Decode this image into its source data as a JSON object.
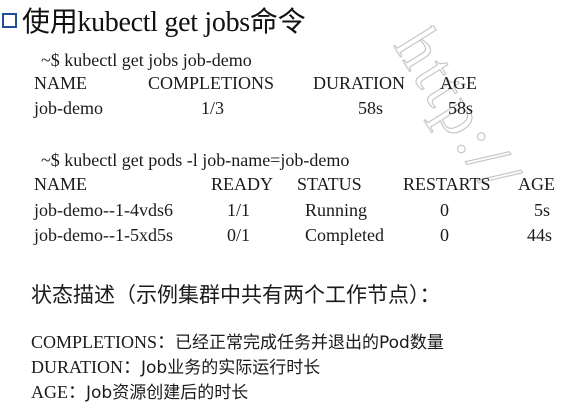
{
  "title": {
    "text": "使用kubectl get jobs命令"
  },
  "jobs_block": {
    "command": "~$ kubectl get jobs job-demo",
    "headers": [
      "NAME",
      "COMPLETIONS",
      "DURATION",
      "AGE"
    ],
    "rows": [
      [
        "job-demo",
        "1/3",
        "58s",
        "58s"
      ]
    ]
  },
  "pods_block": {
    "command": "~$ kubectl get pods -l job-name=job-demo",
    "headers": [
      "NAME",
      "READY",
      "STATUS",
      "RESTARTS",
      "AGE"
    ],
    "rows": [
      [
        "job-demo--1-4vds6",
        "1/1",
        "Running",
        "0",
        "5s"
      ],
      [
        "job-demo--1-5xd5s",
        "0/1",
        "Completed",
        "0",
        "44s"
      ]
    ]
  },
  "description": {
    "heading": "状态描述（示例集群中共有两个工作节点）：",
    "items": [
      {
        "term": "COMPLETIONS：",
        "definition": "已经正常完成任务并退出的Pod数量"
      },
      {
        "term": "DURATION：",
        "definition": "Job业务的实际运行时长"
      },
      {
        "term": "AGE：",
        "definition": "Job资源创建后的时长"
      }
    ]
  },
  "watermark": {
    "text": "http://",
    "color": "#c8c8c8"
  },
  "colors": {
    "bullet": "#1f4e9c",
    "text": "#1a1a1a"
  }
}
